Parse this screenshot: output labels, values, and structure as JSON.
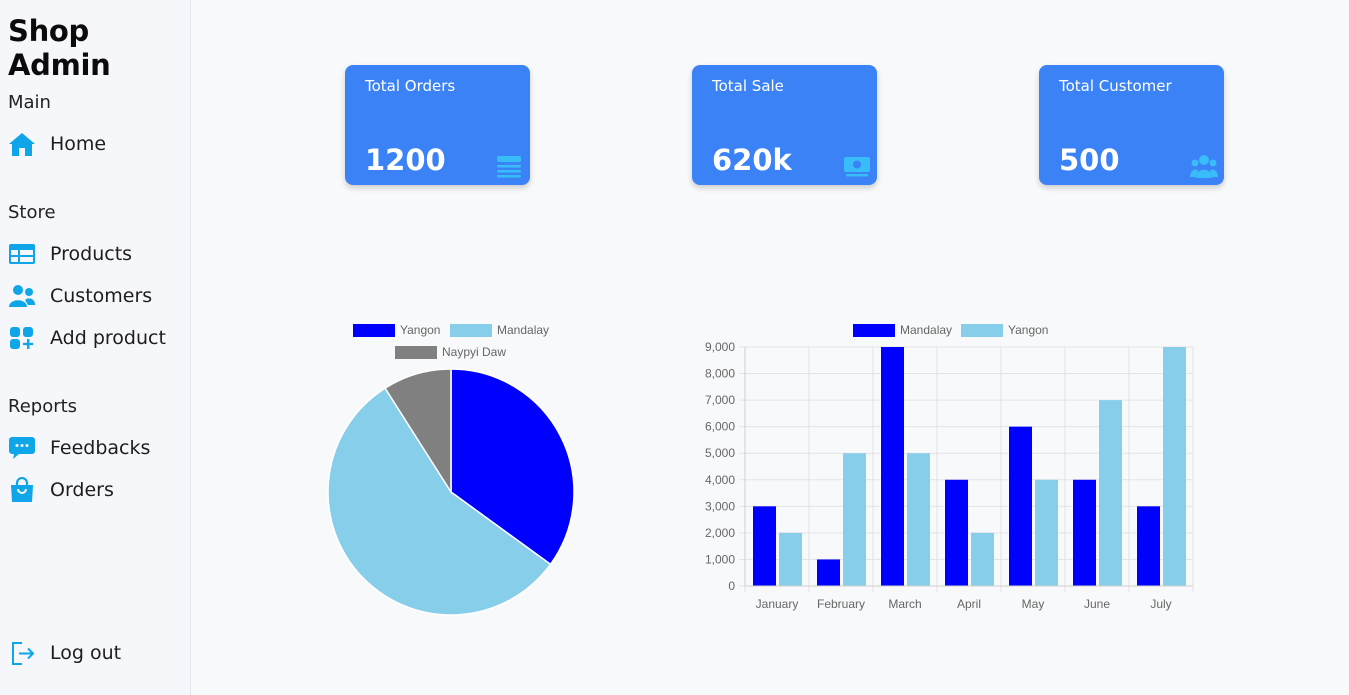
{
  "sidebar": {
    "brand": "Shop Admin",
    "sections": {
      "main": "Main",
      "store": "Store",
      "reports": "Reports"
    },
    "items": {
      "home": {
        "label": "Home",
        "icon": "home-icon"
      },
      "products": {
        "label": "Products",
        "icon": "table-icon"
      },
      "customers": {
        "label": "Customers",
        "icon": "users-icon"
      },
      "add_product": {
        "label": "Add product",
        "icon": "grid-plus-icon"
      },
      "feedbacks": {
        "label": "Feedbacks",
        "icon": "chat-icon"
      },
      "orders": {
        "label": "Orders",
        "icon": "shopping-bag-icon"
      },
      "logout": {
        "label": "Log out",
        "icon": "logout-icon"
      }
    },
    "icon_color": "#0ea5e9"
  },
  "cards": [
    {
      "title": "Total Orders",
      "value": "1200",
      "icon": "list-icon"
    },
    {
      "title": "Total Sale",
      "value": "620k",
      "icon": "money-icon"
    },
    {
      "title": "Total Customer",
      "value": "500",
      "icon": "customers-icon"
    }
  ],
  "colors": {
    "card_bg": "#3b82f6",
    "card_icon": "#38bdf8"
  },
  "chart_data": [
    {
      "type": "pie",
      "labels": [
        "Yangon",
        "Mandalay",
        "Naypyi Daw"
      ],
      "values": [
        35,
        56,
        9
      ],
      "colors": [
        "#0000ff",
        "#87ceeb",
        "#808080"
      ],
      "legend": "top"
    },
    {
      "type": "bar",
      "categories": [
        "January",
        "February",
        "March",
        "April",
        "May",
        "June",
        "July"
      ],
      "series": [
        {
          "name": "Mandalay",
          "values": [
            3000,
            1000,
            9000,
            4000,
            6000,
            4000,
            3000
          ],
          "color": "#0000ff"
        },
        {
          "name": "Yangon",
          "values": [
            2000,
            5000,
            5000,
            2000,
            4000,
            7000,
            9000
          ],
          "color": "#87ceeb"
        }
      ],
      "ylim": [
        0,
        9000
      ],
      "yticks": [
        "0",
        "1,000",
        "2,000",
        "3,000",
        "4,000",
        "5,000",
        "6,000",
        "7,000",
        "8,000",
        "9,000"
      ],
      "grid": true,
      "legend": "top"
    }
  ]
}
